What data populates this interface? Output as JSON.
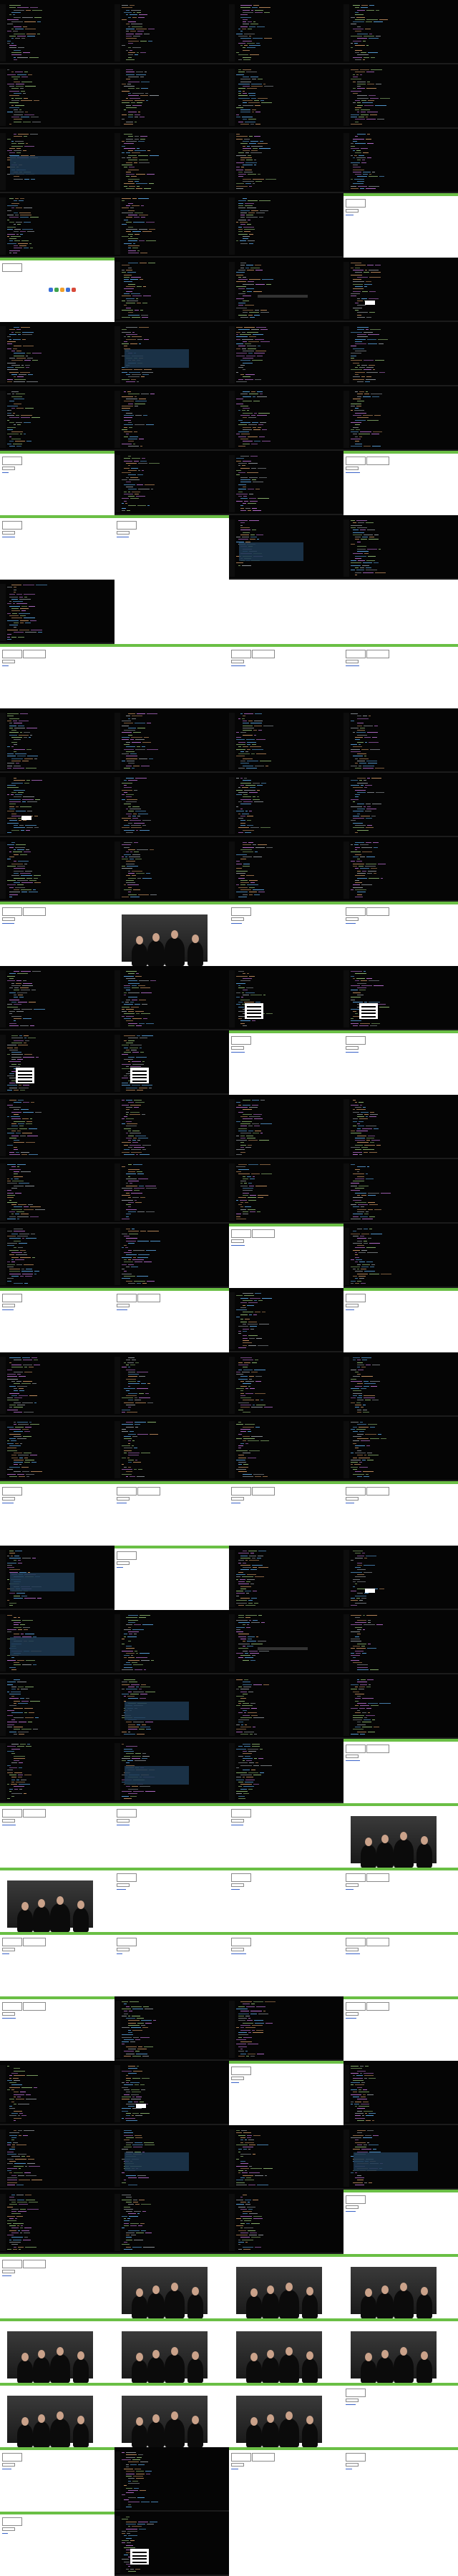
{
  "sheet": {
    "background": "#000000"
  },
  "palette": {
    "accent_green": "#6abf45",
    "code_grey": "#9aa0a6",
    "code_green": "#98c379",
    "code_blue": "#61afef",
    "code_purple": "#c678dd",
    "code_orange": "#d19a66",
    "selection": "#1f3a52"
  },
  "frames": [
    {
      "kind": "dark",
      "variant": "code-a"
    },
    {
      "kind": "dark",
      "variant": "code-b"
    },
    {
      "kind": "dark",
      "variant": "code-a"
    },
    {
      "kind": "dark",
      "variant": "code-b"
    },
    {
      "kind": "dark",
      "variant": "code-a"
    },
    {
      "kind": "dark",
      "variant": "code-b"
    },
    {
      "kind": "dark",
      "variant": "code-a"
    },
    {
      "kind": "dark",
      "variant": "code-b"
    },
    {
      "kind": "dark",
      "variant": "code-c",
      "overlay": "selection"
    },
    {
      "kind": "dark",
      "variant": "code-a"
    },
    {
      "kind": "dark",
      "variant": "code-b"
    },
    {
      "kind": "dark",
      "variant": "code-a"
    },
    {
      "kind": "dark",
      "variant": "code-a"
    },
    {
      "kind": "dark",
      "variant": "code-b"
    },
    {
      "kind": "dark",
      "variant": "code-c"
    },
    {
      "kind": "light",
      "variant": "browser-form"
    },
    {
      "kind": "light",
      "variant": "browser-icons"
    },
    {
      "kind": "dark",
      "variant": "code-a"
    },
    {
      "kind": "dark",
      "variant": "code-b",
      "overlay": "dialog-line"
    },
    {
      "kind": "dark",
      "variant": "code-a",
      "overlay": "small-box"
    },
    {
      "kind": "dark",
      "variant": "code-a"
    },
    {
      "kind": "dark",
      "variant": "code-b",
      "overlay": "selection"
    },
    {
      "kind": "dark",
      "variant": "code-a"
    },
    {
      "kind": "dark",
      "variant": "code-b"
    },
    {
      "kind": "dark",
      "variant": "code-a"
    },
    {
      "kind": "dark",
      "variant": "code-b"
    },
    {
      "kind": "dark",
      "variant": "code-a"
    },
    {
      "kind": "dark",
      "variant": "code-b"
    },
    {
      "kind": "light",
      "variant": "browser-form"
    },
    {
      "kind": "dark",
      "variant": "code-a"
    },
    {
      "kind": "dark",
      "variant": "code-b"
    },
    {
      "kind": "light",
      "variant": "browser-form"
    },
    {
      "kind": "light",
      "variant": "browser-form"
    },
    {
      "kind": "light",
      "variant": "browser-form"
    },
    {
      "kind": "dark",
      "variant": "code-c",
      "overlay": "selection"
    },
    {
      "kind": "dark",
      "variant": "code-a"
    },
    {
      "kind": "dark",
      "variant": "code-a"
    },
    {
      "kind": "empty"
    },
    {
      "kind": "empty"
    },
    {
      "kind": "empty"
    },
    {
      "kind": "light",
      "variant": "browser-form"
    },
    {
      "kind": "light",
      "variant": "browser-blank"
    },
    {
      "kind": "light",
      "variant": "browser-form"
    },
    {
      "kind": "light",
      "variant": "browser-form"
    },
    {
      "kind": "dark",
      "variant": "code-a"
    },
    {
      "kind": "dark",
      "variant": "code-b"
    },
    {
      "kind": "dark",
      "variant": "code-a"
    },
    {
      "kind": "dark",
      "variant": "code-b"
    },
    {
      "kind": "dark",
      "variant": "code-a",
      "overlay": "small-box"
    },
    {
      "kind": "dark",
      "variant": "code-b"
    },
    {
      "kind": "dark",
      "variant": "code-a"
    },
    {
      "kind": "dark",
      "variant": "code-b"
    },
    {
      "kind": "dark",
      "variant": "code-a"
    },
    {
      "kind": "dark",
      "variant": "code-b"
    },
    {
      "kind": "dark",
      "variant": "code-a"
    },
    {
      "kind": "dark",
      "variant": "code-b"
    },
    {
      "kind": "light",
      "variant": "browser-form"
    },
    {
      "kind": "light",
      "variant": "photo"
    },
    {
      "kind": "light",
      "variant": "browser-form"
    },
    {
      "kind": "light",
      "variant": "browser-form"
    },
    {
      "kind": "dark",
      "variant": "code-a"
    },
    {
      "kind": "dark",
      "variant": "code-b"
    },
    {
      "kind": "dark",
      "variant": "code-a",
      "overlay": "menu"
    },
    {
      "kind": "dark",
      "variant": "code-b",
      "overlay": "menu"
    },
    {
      "kind": "dark",
      "variant": "code-a",
      "overlay": "menu"
    },
    {
      "kind": "dark",
      "variant": "code-b",
      "overlay": "menu"
    },
    {
      "kind": "light",
      "variant": "browser-form"
    },
    {
      "kind": "light",
      "variant": "browser-form"
    },
    {
      "kind": "dark",
      "variant": "code-a"
    },
    {
      "kind": "dark",
      "variant": "code-b"
    },
    {
      "kind": "dark",
      "variant": "code-a"
    },
    {
      "kind": "dark",
      "variant": "code-b"
    },
    {
      "kind": "dark",
      "variant": "code-a"
    },
    {
      "kind": "dark",
      "variant": "code-b"
    },
    {
      "kind": "dark",
      "variant": "code-a"
    },
    {
      "kind": "dark",
      "variant": "code-b"
    },
    {
      "kind": "dark",
      "variant": "code-a"
    },
    {
      "kind": "dark",
      "variant": "code-b"
    },
    {
      "kind": "light",
      "variant": "browser-form"
    },
    {
      "kind": "dark",
      "variant": "code-a"
    },
    {
      "kind": "light",
      "variant": "browser-form"
    },
    {
      "kind": "light",
      "variant": "browser-form"
    },
    {
      "kind": "dark",
      "variant": "code-a"
    },
    {
      "kind": "light",
      "variant": "browser-form"
    },
    {
      "kind": "dark",
      "variant": "code-a"
    },
    {
      "kind": "dark",
      "variant": "code-b"
    },
    {
      "kind": "dark",
      "variant": "code-a"
    },
    {
      "kind": "dark",
      "variant": "code-b"
    },
    {
      "kind": "dark",
      "variant": "code-a"
    },
    {
      "kind": "dark",
      "variant": "code-b"
    },
    {
      "kind": "dark",
      "variant": "code-a"
    },
    {
      "kind": "dark",
      "variant": "code-b"
    },
    {
      "kind": "light",
      "variant": "browser-form"
    },
    {
      "kind": "light",
      "variant": "browser-form"
    },
    {
      "kind": "light",
      "variant": "browser-form"
    },
    {
      "kind": "light",
      "variant": "browser-form"
    },
    {
      "kind": "dark",
      "variant": "code-a",
      "overlay": "selection"
    },
    {
      "kind": "light",
      "variant": "browser-form"
    },
    {
      "kind": "dark",
      "variant": "code-a"
    },
    {
      "kind": "dark",
      "variant": "code-b",
      "overlay": "small-box"
    },
    {
      "kind": "dark",
      "variant": "code-a",
      "overlay": "selection"
    },
    {
      "kind": "dark",
      "variant": "code-b"
    },
    {
      "kind": "dark",
      "variant": "code-c",
      "overlay": "dialog-line"
    },
    {
      "kind": "dark",
      "variant": "code-b"
    },
    {
      "kind": "dark",
      "variant": "code-a"
    },
    {
      "kind": "dark",
      "variant": "code-b",
      "overlay": "selection"
    },
    {
      "kind": "dark",
      "variant": "code-a"
    },
    {
      "kind": "dark",
      "variant": "code-b"
    },
    {
      "kind": "dark",
      "variant": "code-a"
    },
    {
      "kind": "dark",
      "variant": "code-b",
      "overlay": "selection"
    },
    {
      "kind": "dark",
      "variant": "code-a"
    },
    {
      "kind": "light",
      "variant": "browser-form"
    },
    {
      "kind": "light",
      "variant": "browser-form"
    },
    {
      "kind": "light",
      "variant": "browser-form"
    },
    {
      "kind": "light",
      "variant": "browser-form"
    },
    {
      "kind": "light",
      "variant": "photo"
    },
    {
      "kind": "light",
      "variant": "photo"
    },
    {
      "kind": "light",
      "variant": "browser-form"
    },
    {
      "kind": "light",
      "variant": "browser-form"
    },
    {
      "kind": "light",
      "variant": "browser-form"
    },
    {
      "kind": "light",
      "variant": "browser-form"
    },
    {
      "kind": "light",
      "variant": "browser-form"
    },
    {
      "kind": "light",
      "variant": "browser-form"
    },
    {
      "kind": "light",
      "variant": "browser-form"
    },
    {
      "kind": "light",
      "variant": "browser-form"
    },
    {
      "kind": "dark",
      "variant": "code-a"
    },
    {
      "kind": "dark",
      "variant": "code-b"
    },
    {
      "kind": "light",
      "variant": "browser-form"
    },
    {
      "kind": "dark",
      "variant": "code-a"
    },
    {
      "kind": "dark",
      "variant": "code-b",
      "overlay": "small-box"
    },
    {
      "kind": "light",
      "variant": "browser-form"
    },
    {
      "kind": "dark",
      "variant": "code-a"
    },
    {
      "kind": "dark",
      "variant": "code-a"
    },
    {
      "kind": "dark",
      "variant": "code-b",
      "overlay": "selection"
    },
    {
      "kind": "dark",
      "variant": "code-a"
    },
    {
      "kind": "dark",
      "variant": "code-b",
      "overlay": "selection"
    },
    {
      "kind": "dark",
      "variant": "code-a"
    },
    {
      "kind": "dark",
      "variant": "code-b"
    },
    {
      "kind": "dark",
      "variant": "code-a"
    },
    {
      "kind": "light",
      "variant": "browser-form"
    },
    {
      "kind": "light",
      "variant": "browser-form"
    },
    {
      "kind": "light",
      "variant": "photo"
    },
    {
      "kind": "light",
      "variant": "photo"
    },
    {
      "kind": "light",
      "variant": "photo"
    },
    {
      "kind": "light",
      "variant": "photo"
    },
    {
      "kind": "light",
      "variant": "photo"
    },
    {
      "kind": "light",
      "variant": "photo"
    },
    {
      "kind": "light",
      "variant": "photo"
    },
    {
      "kind": "light",
      "variant": "photo"
    },
    {
      "kind": "light",
      "variant": "photo"
    },
    {
      "kind": "light",
      "variant": "photo"
    },
    {
      "kind": "light",
      "variant": "browser-form"
    },
    {
      "kind": "light",
      "variant": "browser-form"
    },
    {
      "kind": "dark",
      "variant": "code-a"
    },
    {
      "kind": "light",
      "variant": "browser-form"
    },
    {
      "kind": "light",
      "variant": "browser-form"
    },
    {
      "kind": "light",
      "variant": "browser-form"
    },
    {
      "kind": "dark",
      "variant": "code-a",
      "overlay": "menu"
    },
    {
      "kind": "empty"
    },
    {
      "kind": "empty"
    }
  ]
}
